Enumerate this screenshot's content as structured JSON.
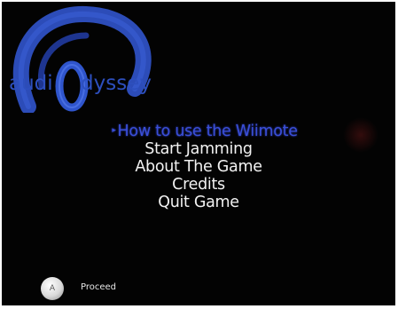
{
  "logo": {
    "text_left": "audi",
    "text_right": "dyssey",
    "icon": "headphones-o-icon",
    "color": "#2d4fbe"
  },
  "menu": {
    "selected_index": 0,
    "selection_marker": "▸",
    "items": [
      "How to use the Wiimote",
      "Start Jamming",
      "About The Game",
      "Credits",
      "Quit Game"
    ],
    "selected_color": "#3a4fd8",
    "item_color": "#f2f2f2"
  },
  "hint": {
    "button_label": "A",
    "action_label": "Proceed"
  },
  "background_color": "#030303"
}
